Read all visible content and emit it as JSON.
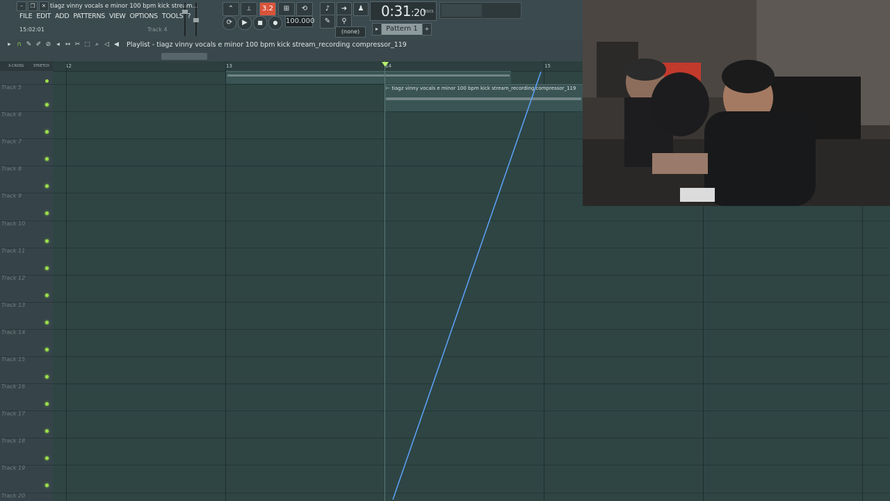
{
  "window": {
    "title": "tiagz vinny vocals e minor 100 bpm kick stream...",
    "time_info": "15:02:01",
    "track_info": "Track 4"
  },
  "menu": [
    "FILE",
    "EDIT",
    "ADD",
    "PATTERNS",
    "VIEW",
    "OPTIONS",
    "TOOLS",
    "?"
  ],
  "transport": {
    "pattern_song": "3.2",
    "tempo": "100.000",
    "time_main": "0:31",
    "time_sub": "20",
    "time_unit_label": "M:S:CS",
    "snap": "(none)",
    "pattern": "Pattern 1"
  },
  "playlist": {
    "title": "Playlist - tiagz vinny vocals e minor 100 bpm kick stream_recording compressor_119",
    "ruler": [
      "12",
      "13",
      "14",
      "15"
    ],
    "xcross_label": "X-CROSS",
    "stretch_label": "STRETCH"
  },
  "clip": {
    "label": "tiagz vinny vocals e minor 100 bpm kick stream_recording compressor_119"
  },
  "tracks": [
    "Track 5",
    "Track 6",
    "Track 7",
    "Track 8",
    "Track 9",
    "Track 10",
    "Track 11",
    "Track 12",
    "Track 13",
    "Track 14",
    "Track 15",
    "Track 16",
    "Track 17",
    "Track 18",
    "Track 19",
    "Track 20"
  ],
  "colors": {
    "accent": "#d9533a",
    "playhead": "#b6f06a",
    "automation": "#5b9ef0",
    "grid_bg": "#2e4544",
    "led": "#9ee04a"
  }
}
